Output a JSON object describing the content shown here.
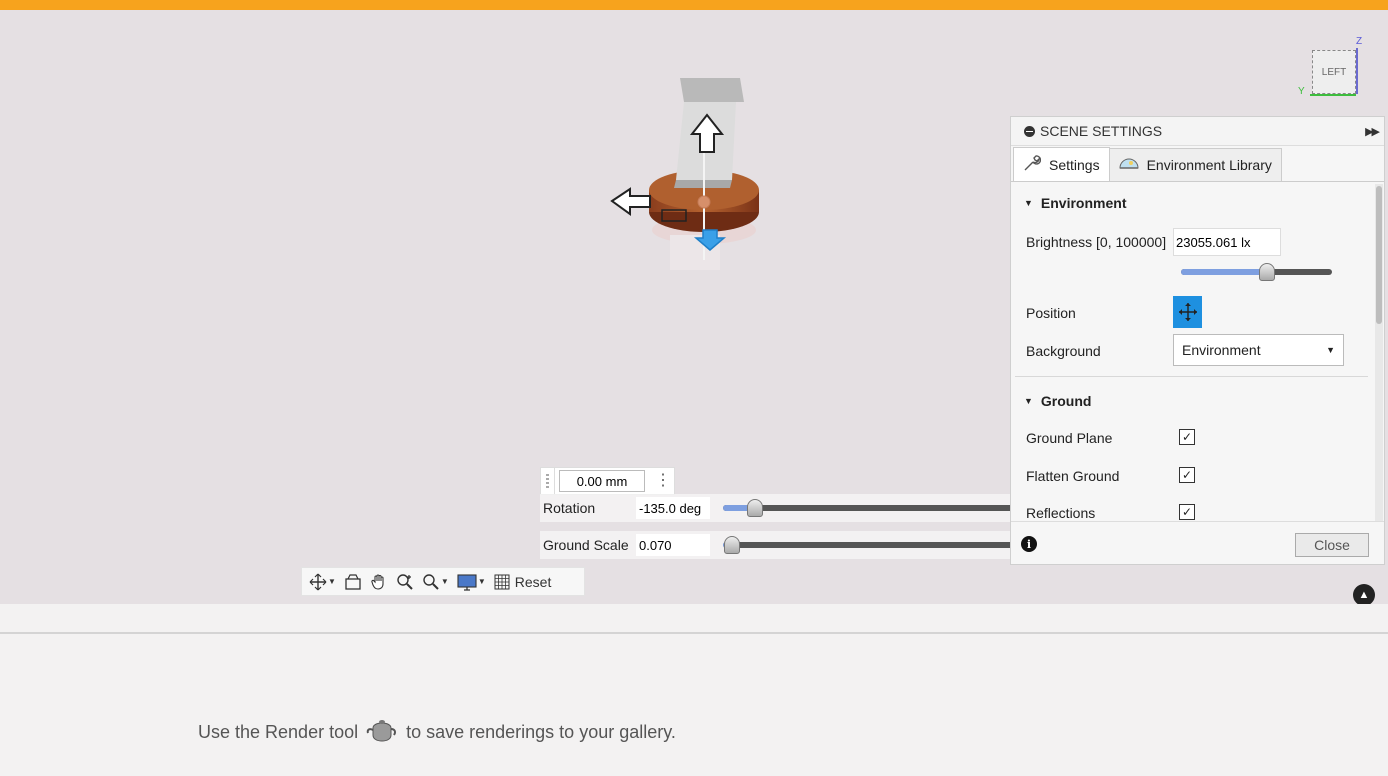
{
  "view_cube": {
    "face_label": "LEFT",
    "axis_z": "Z",
    "axis_y": "Y"
  },
  "distance_input": {
    "value": "0.00 mm"
  },
  "rotation": {
    "label": "Rotation",
    "value": "-135.0 deg",
    "level": 0.11
  },
  "ground_scale": {
    "label": "Ground Scale",
    "value": "0.070",
    "level": 0.03
  },
  "toolbar": {
    "reset_label": "Reset"
  },
  "scene_settings": {
    "title": "SCENE SETTINGS",
    "tabs": [
      {
        "label": "Settings",
        "icon": "wrench-icon"
      },
      {
        "label": "Environment Library",
        "icon": "environment-dome-icon"
      }
    ],
    "environment": {
      "heading": "Environment",
      "brightness_label": "Brightness [0, 100000]",
      "brightness_value": "23055.061 lx",
      "brightness_level": 0.57,
      "position_label": "Position",
      "background_label": "Background",
      "background_value": "Environment"
    },
    "ground": {
      "heading": "Ground",
      "items": [
        {
          "label": "Ground Plane",
          "checked": true
        },
        {
          "label": "Flatten Ground",
          "checked": true
        },
        {
          "label": "Reflections",
          "checked": true
        }
      ]
    },
    "close_label": "Close"
  },
  "gallery": {
    "message_before": "Use the Render tool",
    "message_after": "to save renderings to your gallery."
  },
  "colors": {
    "accent_bar": "#f7a31d",
    "selected_blue": "#1e90e0",
    "slider_fill": "#7e9fe0"
  }
}
